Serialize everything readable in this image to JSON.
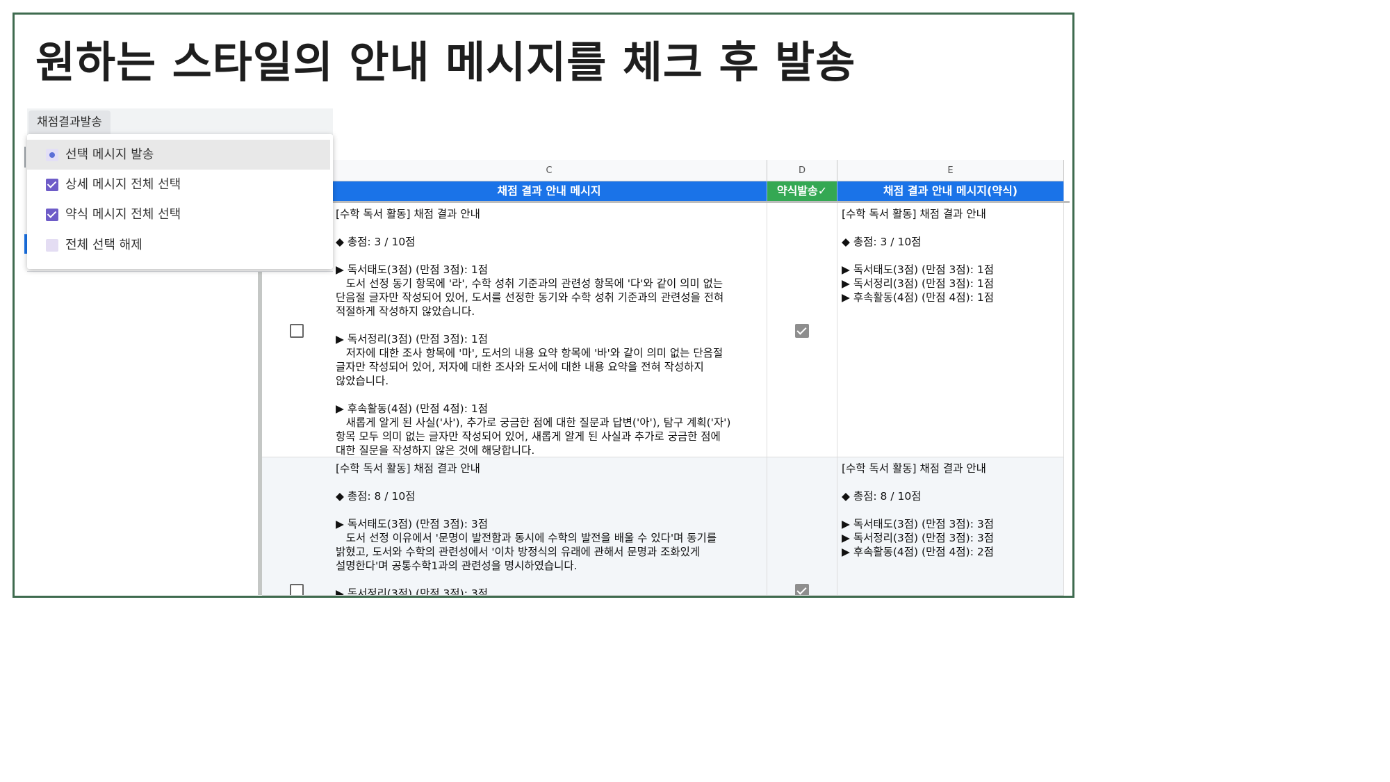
{
  "slide": {
    "title": "원하는 스타일의 안내 메시지를 체크 후 발송"
  },
  "menu": {
    "trigger_label": "채점결과발송",
    "items": [
      {
        "label": "선택 메시지 발송",
        "icon": "radio-dot-icon"
      },
      {
        "label": "상세 메시지 전체 선택",
        "icon": "checkbox-checked-icon"
      },
      {
        "label": "약식 메시지 전체 선택",
        "icon": "checkbox-checked-icon"
      },
      {
        "label": "전체 선택 해제",
        "icon": "checkbox-empty-icon"
      }
    ]
  },
  "sheet": {
    "columns": [
      "C",
      "D",
      "E"
    ],
    "headers": {
      "c": "채점 결과 안내 메시지",
      "d": "약식발송✓",
      "e": "채점 결과 안내 메시지(약식)"
    },
    "colors": {
      "header_blue": "#1a73e8",
      "header_green": "#34a853"
    },
    "rows": [
      {
        "detail_checked": false,
        "brief_checked": true,
        "c": "[수학 독서 활동] 채점 결과 안내\n\n◆ 총점: 3 / 10점\n\n▶ 독서태도(3점) (만점 3점): 1점\n   도서 선정 동기 항목에 '라', 수학 성취 기준과의 관련성 항목에 '다'와 같이 의미 없는\n단음절 글자만 작성되어 있어, 도서를 선정한 동기와 수학 성취 기준과의 관련성을 전혀\n적절하게 작성하지 않았습니다.\n\n▶ 독서정리(3점) (만점 3점): 1점\n   저자에 대한 조사 항목에 '마', 도서의 내용 요약 항목에 '바'와 같이 의미 없는 단음절\n글자만 작성되어 있어, 저자에 대한 조사와 도서에 대한 내용 요약을 전혀 작성하지\n않았습니다.\n\n▶ 후속활동(4점) (만점 4점): 1점\n   새롭게 알게 된 사실('사'), 추가로 궁금한 점에 대한 질문과 답변('아'), 탐구 계획('자')\n항목 모두 의미 없는 글자만 작성되어 있어, 새롭게 알게 된 사실과 추가로 궁금한 점에\n대한 질문을 작성하지 않은 것에 해당합니다.",
        "e": "[수학 독서 활동] 채점 결과 안내\n\n◆ 총점: 3 / 10점\n\n▶ 독서태도(3점) (만점 3점): 1점\n▶ 독서정리(3점) (만점 3점): 1점\n▶ 후속활동(4점) (만점 4점): 1점"
      },
      {
        "detail_checked": false,
        "brief_checked": true,
        "c": "[수학 독서 활동] 채점 결과 안내\n\n◆ 총점: 8 / 10점\n\n▶ 독서태도(3점) (만점 3점): 3점\n   도서 선정 이유에서 '문명이 발전함과 동시에 수학의 발전을 배울 수 있다'며 동기를\n밝혔고, 도서와 수학의 관련성에서 '이차 방정식의 유래에 관해서 문명과 조화있게\n설명한다'며 공통수학1과의 관련성을 명시하였습니다.\n\n▶ 독서정리(3점) (만점 3점): 3점",
        "e": "[수학 독서 활동] 채점 결과 안내\n\n◆ 총점: 8 / 10점\n\n▶ 독서태도(3점) (만점 3점): 3점\n▶ 독서정리(3점) (만점 3점): 3점\n▶ 후속활동(4점) (만점 4점): 2점"
      }
    ]
  }
}
